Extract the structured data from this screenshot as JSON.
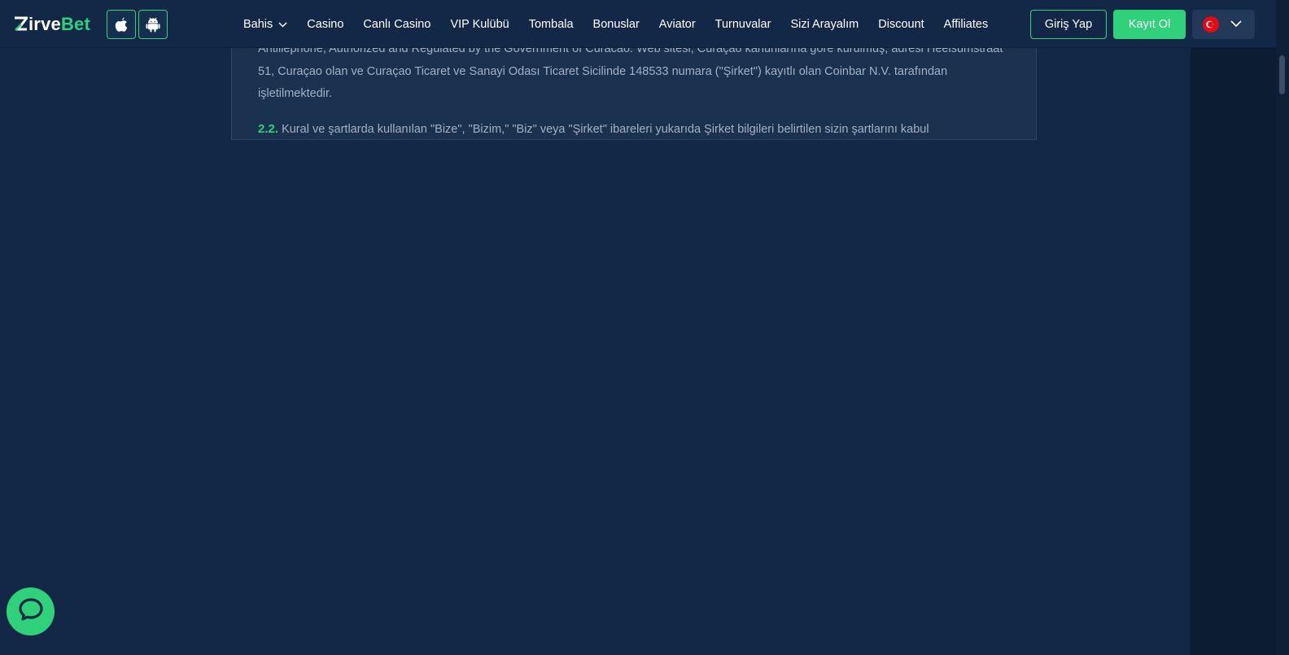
{
  "brand": {
    "logo_white": "irve",
    "logo_green": "Bet",
    "accent_color": "#2fd17a"
  },
  "apps": {
    "ios_icon": "apple-icon",
    "android_icon": "android-icon"
  },
  "nav": {
    "items": [
      {
        "label": "Bahis",
        "has_dropdown": true
      },
      {
        "label": "Casino"
      },
      {
        "label": "Canlı Casino"
      },
      {
        "label": "VIP Kulübü"
      },
      {
        "label": "Tombala"
      },
      {
        "label": "Bonuslar"
      },
      {
        "label": "Aviator"
      },
      {
        "label": "Turnuvalar"
      },
      {
        "label": "Sizi Arayalım"
      },
      {
        "label": "Discount"
      },
      {
        "label": "Affiliates"
      }
    ]
  },
  "auth": {
    "login_label": "Giriş Yap",
    "register_label": "Kayıt Ol"
  },
  "language": {
    "flag_icon": "turkey-flag-icon"
  },
  "content": {
    "para1": "Antillephone, Authorized and Regulated by the Government of Curacao. Web sitesi, Curaçao kanunlarına göre kurulmuş, adresi Heelsumstraat 51, Curaçao olan ve Curaçao Ticaret ve Sanayi Odası Ticaret Sicilinde 148533 numara (\"Şirket\") kayıtlı olan Coinbar N.V. tarafından işletilmektedir.",
    "para2_num": "2.2.",
    "para2": "Kural ve şartlarda kullanılan \"Bize\", \"Bizim,\" \"Biz\" veya \"Şirket\" ibareleri yukarıda Şirket bilgileri belirtilen sizin şartlarını kabul"
  },
  "chat": {
    "icon": "chat-icon"
  }
}
